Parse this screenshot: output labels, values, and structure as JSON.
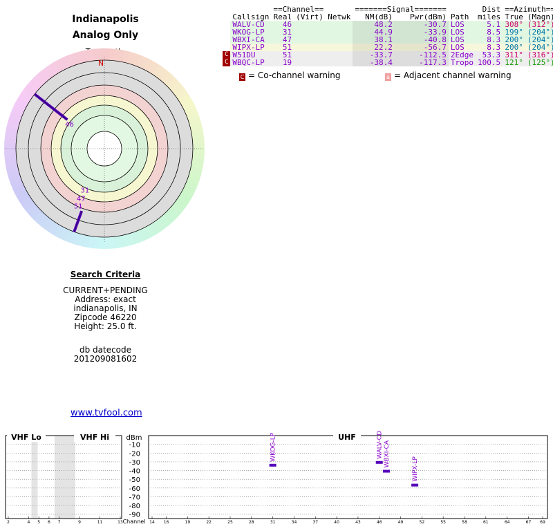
{
  "location": {
    "title1": "Indianapolis",
    "title2": "Analog Only"
  },
  "compass": {
    "true_north": "TrueNorth",
    "north": "N"
  },
  "table": {
    "group_headers": {
      "channel": "==Channel==",
      "signal": "=======Signal=======",
      "dist": "Dist",
      "azimuth": "==Azimuth=="
    },
    "columns": {
      "callsign": "Callsign",
      "real": "Real",
      "virt": "(Virt)",
      "netwk": "Netwk",
      "nm": "NM(dB)",
      "pwr": "Pwr(dBm)",
      "path": "Path",
      "miles": "miles",
      "true": "True",
      "magn": "(Magn)"
    },
    "rows": [
      {
        "warn": "",
        "callsign": "WALV-CD",
        "real": "46",
        "virt": "",
        "netwk": "",
        "nm": "48.2",
        "pwr": "-30.7",
        "path": "LOS",
        "dist": "5.1",
        "az_true": "308°",
        "az_magn": "(312°)",
        "color": "#8800cc",
        "azcolor": "#cc0066",
        "bg": "#e2f7e2"
      },
      {
        "warn": "",
        "callsign": "WKOG-LP",
        "real": "31",
        "virt": "",
        "netwk": "",
        "nm": "44.9",
        "pwr": "-33.9",
        "path": "LOS",
        "dist": "8.5",
        "az_true": "199°",
        "az_magn": "(204°)",
        "color": "#8800cc",
        "azcolor": "#0077aa",
        "bg": "#e2f7e2"
      },
      {
        "warn": "",
        "callsign": "WBXI-CA",
        "real": "47",
        "virt": "",
        "netwk": "",
        "nm": "38.1",
        "pwr": "-40.8",
        "path": "LOS",
        "dist": "8.3",
        "az_true": "200°",
        "az_magn": "(204°)",
        "color": "#8800cc",
        "azcolor": "#0077aa",
        "bg": "#e2f7e2"
      },
      {
        "warn": "",
        "callsign": "WIPX-LP",
        "real": "51",
        "virt": "",
        "netwk": "",
        "nm": "22.2",
        "pwr": "-56.7",
        "path": "LOS",
        "dist": "8.3",
        "az_true": "200°",
        "az_magn": "(204°)",
        "color": "#8800cc",
        "azcolor": "#0077aa",
        "bg": "#f7f7dc"
      },
      {
        "warn": "C",
        "callsign": "W51DU",
        "real": "51",
        "virt": "",
        "netwk": "",
        "nm": "-33.7",
        "pwr": "-112.5",
        "path": "2Edge",
        "dist": "53.3",
        "az_true": "311°",
        "az_magn": "(316°)",
        "color": "#8800cc",
        "azcolor": "#cc0066",
        "bg": "#eeeeee"
      },
      {
        "warn": "C",
        "callsign": "WBQC-LP",
        "real": "19",
        "virt": "",
        "netwk": "",
        "nm": "-38.4",
        "pwr": "-117.3",
        "path": "Tropo",
        "dist": "100.5",
        "az_true": "121°",
        "az_magn": "(125°)",
        "color": "#8800cc",
        "azcolor": "#119900",
        "bg": "#eeeeee"
      }
    ]
  },
  "legend": {
    "cochannel": "= Co-channel warning",
    "adjacent": "= Adjacent channel warning",
    "cochannel_mark": "C",
    "adjacent_mark": "a"
  },
  "criteria": {
    "heading": "Search Criteria",
    "lines": [
      "CURRENT+PENDING",
      "Address: exact",
      "indianapolis, IN",
      "Zipcode 46220",
      "Height: 25.0 ft."
    ],
    "db_label": "db datecode",
    "db_value": "201209081602"
  },
  "link": "www.tvfool.com",
  "chart_data": [
    {
      "type": "scatter",
      "name": "polar-azimuth",
      "points": [
        {
          "label": "46",
          "azimuth_deg": 308
        },
        {
          "label": "31",
          "azimuth_deg": 199
        },
        {
          "label": "47",
          "azimuth_deg": 200
        },
        {
          "label": "51",
          "azimuth_deg": 200
        }
      ]
    },
    {
      "type": "scatter",
      "name": "channel-spectrum",
      "band_labels": {
        "vhf_lo": "VHF Lo",
        "vhf_hi": "VHF Hi",
        "uhf": "UHF"
      },
      "ylabel": "dBm",
      "xlabel": "Channel",
      "yticks": [
        -10,
        -20,
        -30,
        -40,
        -50,
        -60,
        -70,
        -80,
        -90
      ],
      "ylim": [
        0,
        -95
      ],
      "xticks_vhf": [
        2,
        4,
        5,
        6,
        7,
        9,
        11,
        13
      ],
      "xticks_uhf": [
        14,
        16,
        19,
        22,
        25,
        28,
        31,
        34,
        37,
        40,
        43,
        46,
        49,
        52,
        55,
        58,
        61,
        64,
        67,
        69
      ],
      "points": [
        {
          "callsign": "WKOG-LP",
          "channel": 31,
          "dbm": -33.9
        },
        {
          "callsign": "WALV-CD",
          "channel": 46,
          "dbm": -30.7
        },
        {
          "callsign": "WBXI-CA",
          "channel": 47,
          "dbm": -40.8
        },
        {
          "callsign": "WIPX-LP",
          "channel": 51,
          "dbm": -56.7
        }
      ]
    }
  ]
}
